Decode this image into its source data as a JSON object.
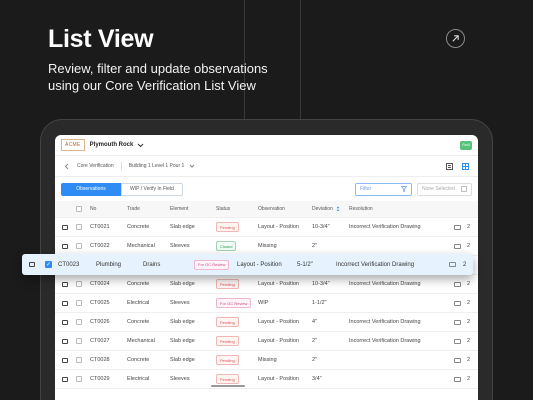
{
  "hero": {
    "title": "List View",
    "subtitle": "Review, filter and update observations using our Core Verification List View"
  },
  "app": {
    "logo": "ACME",
    "project": "Plymouth Rock",
    "avatar": "RedI"
  },
  "breadcrumb": {
    "section": "Core Verification",
    "location": "Building 1 Level 1 Pour 1"
  },
  "tabs": [
    {
      "label": "Observations",
      "active": true
    },
    {
      "label": "WIP / Verify In Field",
      "active": false
    }
  ],
  "filter": {
    "placeholder": "Filter"
  },
  "selection": {
    "label": "None Selected"
  },
  "table": {
    "headers": {
      "no": "No",
      "trade": "Trade",
      "element": "Element",
      "status": "Status",
      "observation": "Observation",
      "deviation": "Deviation",
      "resolution": "Resolution"
    },
    "rows": [
      {
        "no": "CT0021",
        "trade": "Concrete",
        "element": "Slab edge",
        "status": "Pending",
        "status_type": "pending",
        "observation": "Layout - Position",
        "deviation": "10-3/4\"",
        "resolution": "Incorrect Verification Drawing",
        "comments": "2"
      },
      {
        "no": "CT0022",
        "trade": "Mechanical",
        "element": "Sleeves",
        "status": "Closed",
        "status_type": "closed",
        "observation": "Missing",
        "deviation": "2\"",
        "resolution": "",
        "comments": "2"
      },
      {
        "no": "CT0024",
        "trade": "Concrete",
        "element": "Slab edge",
        "status": "Pending",
        "status_type": "pending",
        "observation": "Layout - Position",
        "deviation": "10-3/4\"",
        "resolution": "Incorrect Verification Drawing",
        "comments": "2"
      },
      {
        "no": "CT0025",
        "trade": "Electrical",
        "element": "Sleeves",
        "status": "For GC Review",
        "status_type": "review",
        "observation": "WIP",
        "deviation": "1-1/2\"",
        "resolution": "",
        "comments": "2"
      },
      {
        "no": "CT0026",
        "trade": "Concrete",
        "element": "Slab edge",
        "status": "Pending",
        "status_type": "pending",
        "observation": "Layout - Position",
        "deviation": "4\"",
        "resolution": "Incorrect Verification Drawing",
        "comments": "2"
      },
      {
        "no": "CT0027",
        "trade": "Mechanical",
        "element": "Slab edge",
        "status": "Pending",
        "status_type": "pending",
        "observation": "Layout - Position",
        "deviation": "2\"",
        "resolution": "Incorrect Verification Drawing",
        "comments": "2"
      },
      {
        "no": "CT0028",
        "trade": "Concrete",
        "element": "Slab edge",
        "status": "Pending",
        "status_type": "pending",
        "observation": "Missing",
        "deviation": "2\"",
        "resolution": "",
        "comments": "2"
      },
      {
        "no": "CT0029",
        "trade": "Electrical",
        "element": "Sleeves",
        "status": "Pending",
        "status_type": "pending",
        "observation": "Layout - Position",
        "deviation": "3/4\"",
        "resolution": "",
        "comments": "2"
      }
    ]
  },
  "selected_row": {
    "no": "CT0023",
    "trade": "Plumbing",
    "element": "Drains",
    "status": "For GC Review",
    "status_type": "review",
    "observation": "Layout - Position",
    "deviation": "5-1/2\"",
    "resolution": "Incorrect Verification Drawing",
    "comments": "2"
  },
  "icons": {
    "arrow": "arrow-up-right-icon",
    "chevron": "chevron-down-icon",
    "back": "chevron-left-icon",
    "filter": "funnel-icon",
    "comment": "comment-icon",
    "sort": "sort-icon",
    "row_type": "screen-icon"
  },
  "colors": {
    "accent": "#2f8cf5",
    "pending": "#d9534f",
    "closed": "#2e9a52",
    "review": "#c84a83",
    "selected_row_bg": "#e6f2fd"
  }
}
